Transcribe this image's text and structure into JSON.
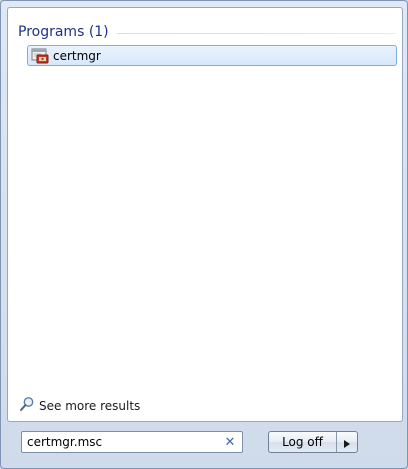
{
  "results": {
    "group_title": "Programs (1)",
    "items": [
      {
        "label": "certmgr",
        "icon": "certificate-manager-icon"
      }
    ]
  },
  "see_more": {
    "label": "See more results",
    "icon": "search-icon"
  },
  "search": {
    "value": "certmgr.msc",
    "clear_icon": "clear-icon"
  },
  "power": {
    "button_label": "Log off",
    "arrow_icon": "chevron-right-icon"
  },
  "colors": {
    "group_title": "#1e3287",
    "selection_border": "#84acdd",
    "clear_icon": "#3f6aa6"
  }
}
